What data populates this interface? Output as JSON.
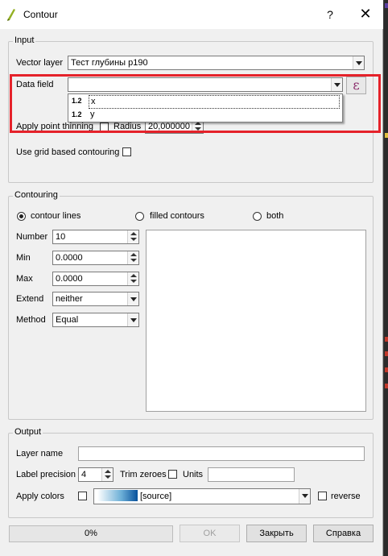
{
  "window": {
    "title": "Contour",
    "help_glyph": "?",
    "close_glyph": "✕"
  },
  "input": {
    "legend": "Input",
    "vector_layer_label": "Vector layer",
    "vector_layer_value": "Тест глубины р190",
    "data_field_label": "Data field",
    "data_field_value": "",
    "dropdown_items": [
      {
        "icon": "1.2",
        "label": "x"
      },
      {
        "icon": "1.2",
        "label": "y"
      }
    ],
    "expression_glyph": "ε",
    "thinning_label": "Apply point thinning",
    "radius_label": "Radius",
    "radius_value": "20,000000",
    "grid_label": "Use grid based contouring"
  },
  "contouring": {
    "legend": "Contouring",
    "radio_lines": "contour lines",
    "radio_filled": "filled contours",
    "radio_both": "both",
    "number_label": "Number",
    "number_value": "10",
    "min_label": "Min",
    "min_value": "0.0000",
    "max_label": "Max",
    "max_value": "0.0000",
    "extend_label": "Extend",
    "extend_value": "neither",
    "method_label": "Method",
    "method_value": "Equal"
  },
  "output": {
    "legend": "Output",
    "layer_name_label": "Layer name",
    "label_precision_label": "Label precision",
    "label_precision_value": "4",
    "trim_zeroes_label": "Trim zeroes",
    "units_label": "Units",
    "apply_colors_label": "Apply colors",
    "color_ramp_value": "[source]",
    "reverse_label": "reverse"
  },
  "footer": {
    "progress_text": "0%",
    "progress_fraction": 0,
    "ok_label": "OK",
    "close_label": "Закрыть",
    "help_label": "Справка"
  },
  "colors": {
    "highlight": "#e5222a",
    "ramp_end": "#08519c"
  }
}
